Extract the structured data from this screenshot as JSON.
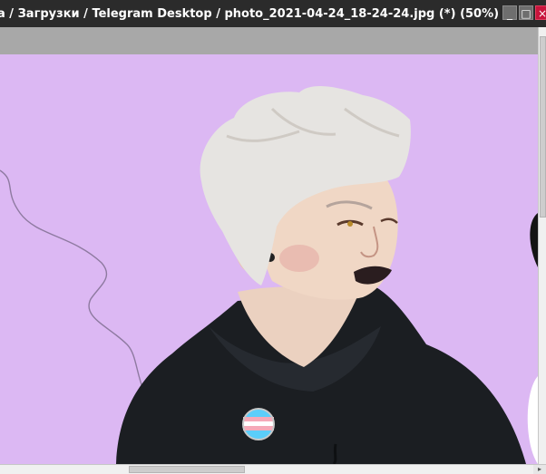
{
  "window": {
    "title": "а / Загрузки / Telegram Desktop / photo_2021-04-24_18-24-24.jpg (*) (50%)",
    "buttons": {
      "minimize": "_",
      "maximize": "□",
      "close": "×"
    }
  },
  "canvas": {
    "background_color": "#dcb8f3",
    "hoodie_color": "#1b1e22",
    "hair_color": "#e6e4e1",
    "skin_color": "#f0d7c5",
    "pin_colors": [
      "#5bcefa",
      "#f5a9b8",
      "#ffffff"
    ]
  },
  "scrollbars": {
    "right_arrow": "▸"
  }
}
